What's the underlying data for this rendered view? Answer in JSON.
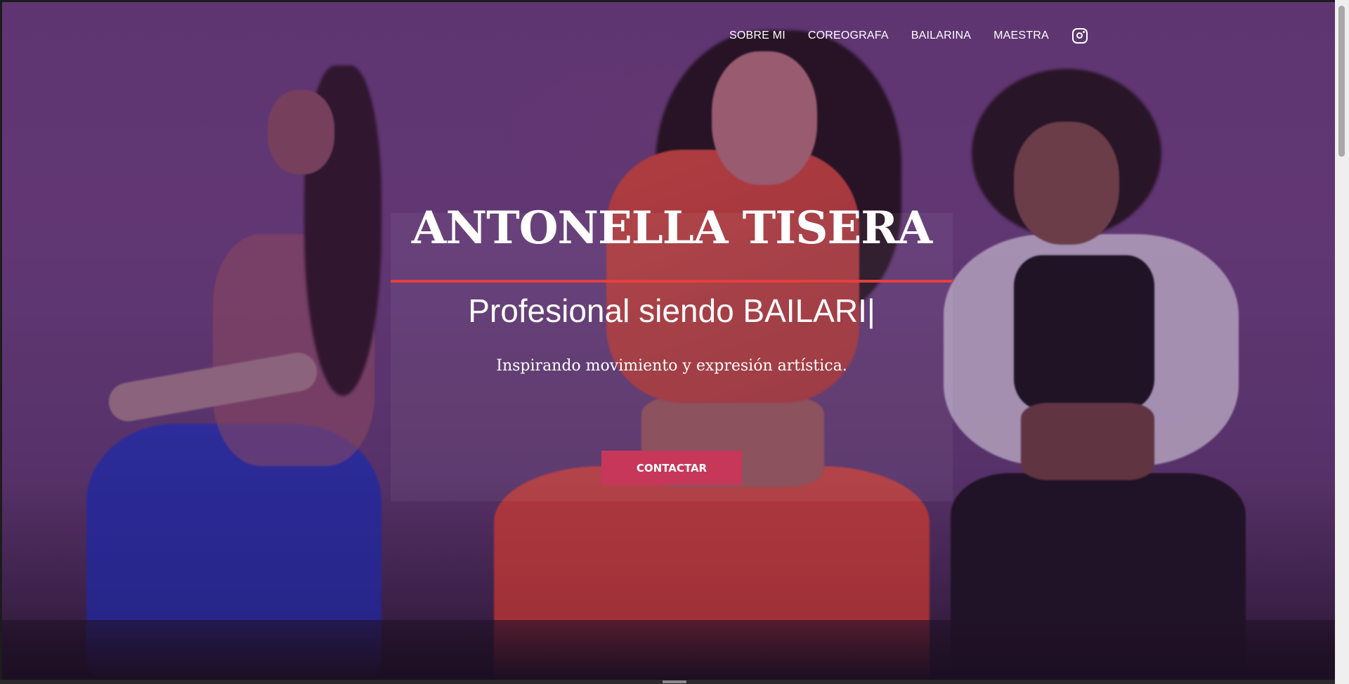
{
  "nav": {
    "items": [
      {
        "label": "SOBRE MI"
      },
      {
        "label": "COREOGRAFA"
      },
      {
        "label": "BAILARINA"
      },
      {
        "label": "MAESTRA"
      }
    ],
    "social_icon": "instagram-icon"
  },
  "hero": {
    "title": "ANTONELLA TISERA",
    "subtitle": "Profesional siendo BAILARI|",
    "tagline": "Inspirando movimiento y expresión artística.",
    "cta_label": "CONTACTAR"
  },
  "colors": {
    "accent_rule": "#e3403f",
    "button": "#c6375a",
    "background_tint": "#6a3f7f"
  }
}
